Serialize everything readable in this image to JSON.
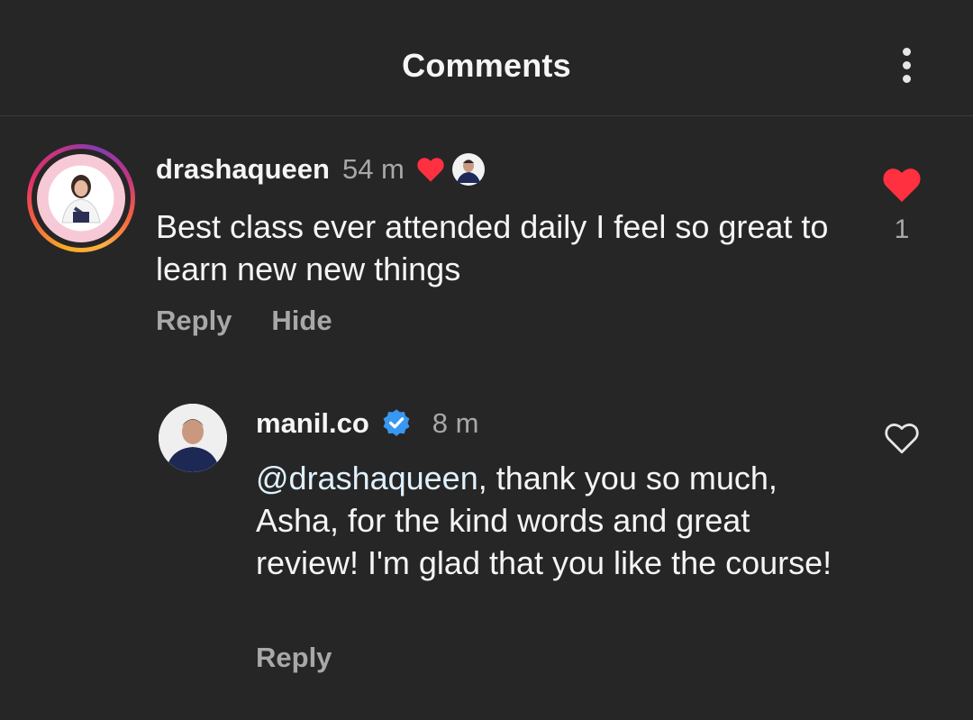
{
  "header": {
    "title": "Comments",
    "more_icon": "more-vertical-icon"
  },
  "comment": {
    "username": "drashaqueen",
    "time": "54 m",
    "liked_by_author_icon": "heart-icon",
    "text": "Best class ever attended daily I feel so great to learn new new things",
    "actions": {
      "reply": "Reply",
      "hide": "Hide"
    },
    "like_count": "1",
    "liked": true,
    "like_color": "#ff3040"
  },
  "reply": {
    "username": "manil.co",
    "verified_icon": "verified-badge-icon",
    "time": "8 m",
    "mention": "@drashaqueen",
    "text": ", thank you so much, Asha, for the kind words and great review! I'm glad that you like the course!",
    "actions": {
      "reply": "Reply"
    },
    "liked": false
  },
  "colors": {
    "background": "#262626",
    "secondary_text": "#a8a8a8",
    "verified": "#3897f0",
    "mention": "#e0f1ff"
  }
}
